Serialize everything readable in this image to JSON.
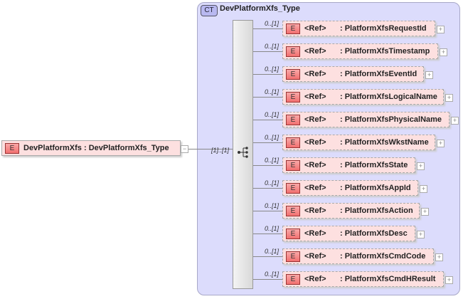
{
  "root": {
    "badge": "E",
    "name": "DevPlatformXfs",
    "type": ": DevPlatformXfs_Type",
    "collapse": "−",
    "cardinality": "[1]..[1]"
  },
  "complex_type": {
    "badge": "CT",
    "name": "DevPlatformXfs_Type"
  },
  "sequence_icon": "sequence-icon",
  "children": [
    {
      "card": "0..[1]",
      "badge": "E",
      "ref": "<Ref>",
      "type": ": PlatformXfsRequestId",
      "expand": "+"
    },
    {
      "card": "0..[1]",
      "badge": "E",
      "ref": "<Ref>",
      "type": ": PlatformXfsTimestamp",
      "expand": "+"
    },
    {
      "card": "0..[1]",
      "badge": "E",
      "ref": "<Ref>",
      "type": ": PlatformXfsEventId",
      "expand": "+"
    },
    {
      "card": "0..[1]",
      "badge": "E",
      "ref": "<Ref>",
      "type": ": PlatformXfsLogicalName",
      "expand": "+"
    },
    {
      "card": "0..[1]",
      "badge": "E",
      "ref": "<Ref>",
      "type": ": PlatformXfsPhysicalName",
      "expand": "+"
    },
    {
      "card": "0..[1]",
      "badge": "E",
      "ref": "<Ref>",
      "type": ": PlatformXfsWkstName",
      "expand": "+"
    },
    {
      "card": "0..[1]",
      "badge": "E",
      "ref": "<Ref>",
      "type": ": PlatformXfsState",
      "expand": "+"
    },
    {
      "card": "0..[1]",
      "badge": "E",
      "ref": "<Ref>",
      "type": ": PlatformXfsAppId",
      "expand": "+"
    },
    {
      "card": "0..[1]",
      "badge": "E",
      "ref": "<Ref>",
      "type": ": PlatformXfsAction",
      "expand": "+"
    },
    {
      "card": "0..[1]",
      "badge": "E",
      "ref": "<Ref>",
      "type": ": PlatformXfsDesc",
      "expand": "+"
    },
    {
      "card": "0..[1]",
      "badge": "E",
      "ref": "<Ref>",
      "type": ": PlatformXfsCmdCode",
      "expand": "+"
    },
    {
      "card": "0..[1]",
      "badge": "E",
      "ref": "<Ref>",
      "type": ": PlatformXfsCmdHResult",
      "expand": "+"
    }
  ]
}
